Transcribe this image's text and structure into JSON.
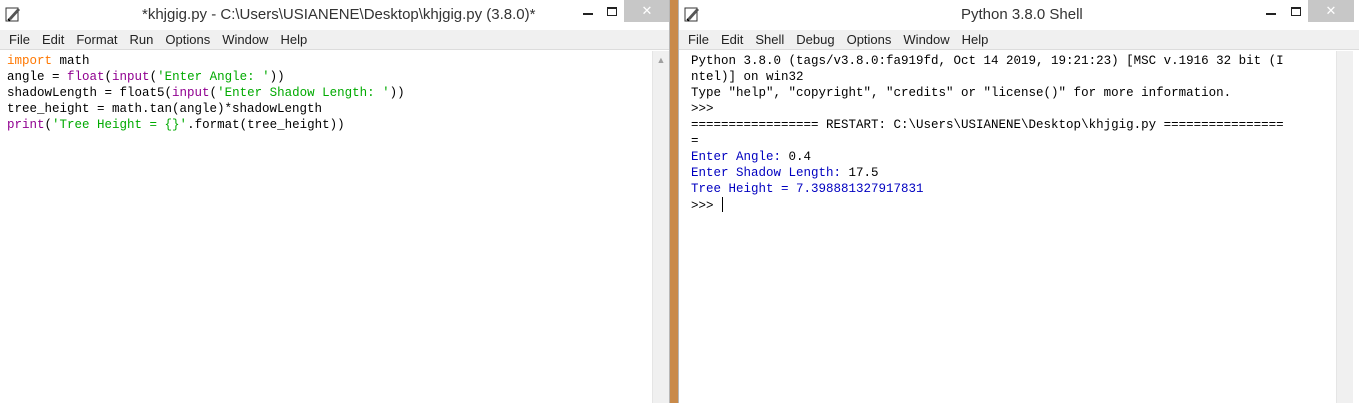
{
  "editor": {
    "title": "*khjgig.py - C:\\Users\\USIANENE\\Desktop\\khjgig.py (3.8.0)*",
    "menu": [
      "File",
      "Edit",
      "Format",
      "Run",
      "Options",
      "Window",
      "Help"
    ],
    "code": [
      [
        {
          "t": "import",
          "c": "kw"
        },
        {
          "t": " math",
          "c": "plain"
        }
      ],
      [
        {
          "t": "angle = ",
          "c": "plain"
        },
        {
          "t": "float",
          "c": "bi"
        },
        {
          "t": "(",
          "c": "plain"
        },
        {
          "t": "input",
          "c": "bi"
        },
        {
          "t": "(",
          "c": "plain"
        },
        {
          "t": "'Enter Angle: '",
          "c": "str"
        },
        {
          "t": "))",
          "c": "plain"
        }
      ],
      [
        {
          "t": "shadowLength = float5(",
          "c": "plain"
        },
        {
          "t": "input",
          "c": "bi"
        },
        {
          "t": "(",
          "c": "plain"
        },
        {
          "t": "'Enter Shadow Length: '",
          "c": "str"
        },
        {
          "t": "))",
          "c": "plain"
        }
      ],
      [
        {
          "t": "tree_height = math.tan(angle)*shadowLength",
          "c": "plain"
        }
      ],
      [
        {
          "t": "print",
          "c": "bi"
        },
        {
          "t": "(",
          "c": "plain"
        },
        {
          "t": "'Tree Height = {}'",
          "c": "str"
        },
        {
          "t": ".format(tree_height))",
          "c": "plain"
        }
      ]
    ]
  },
  "shell": {
    "title": "Python 3.8.0 Shell",
    "menu": [
      "File",
      "Edit",
      "Shell",
      "Debug",
      "Options",
      "Window",
      "Help"
    ],
    "lines": [
      [
        {
          "t": "Python 3.8.0 (tags/v3.8.0:fa919fd, Oct 14 2019, 19:21:23) [MSC v.1916 32 bit (I",
          "c": "shell-out"
        }
      ],
      [
        {
          "t": "ntel)] on win32",
          "c": "shell-out"
        }
      ],
      [
        {
          "t": "Type \"help\", \"copyright\", \"credits\" or \"license()\" for more information.",
          "c": "shell-out"
        }
      ],
      [
        {
          "t": ">>>",
          "c": "shell-out"
        }
      ],
      [
        {
          "t": "================= RESTART: C:\\Users\\USIANENE\\Desktop\\khjgig.py ================",
          "c": "shell-out"
        }
      ],
      [
        {
          "t": "=",
          "c": "shell-out"
        }
      ],
      [
        {
          "t": "Enter Angle: ",
          "c": "shell-user"
        },
        {
          "t": "0.4",
          "c": "shell-in"
        }
      ],
      [
        {
          "t": "Enter Shadow Length: ",
          "c": "shell-user"
        },
        {
          "t": "17.5",
          "c": "shell-in"
        }
      ],
      [
        {
          "t": "Tree Height = 7.398881327917831",
          "c": "shell-user"
        }
      ],
      [
        {
          "t": ">>> ",
          "c": "shell-out"
        },
        {
          "cursor": true
        }
      ]
    ]
  },
  "icons": {
    "app": "idle-feather-icon",
    "minimize": "minimize-icon",
    "maximize": "maximize-icon",
    "close": "close-icon"
  },
  "colors": {
    "keyword": "#ff7700",
    "builtin": "#900090",
    "string": "#00aa00",
    "shell_output": "#0000c0",
    "desktop": "#c98a4a"
  }
}
